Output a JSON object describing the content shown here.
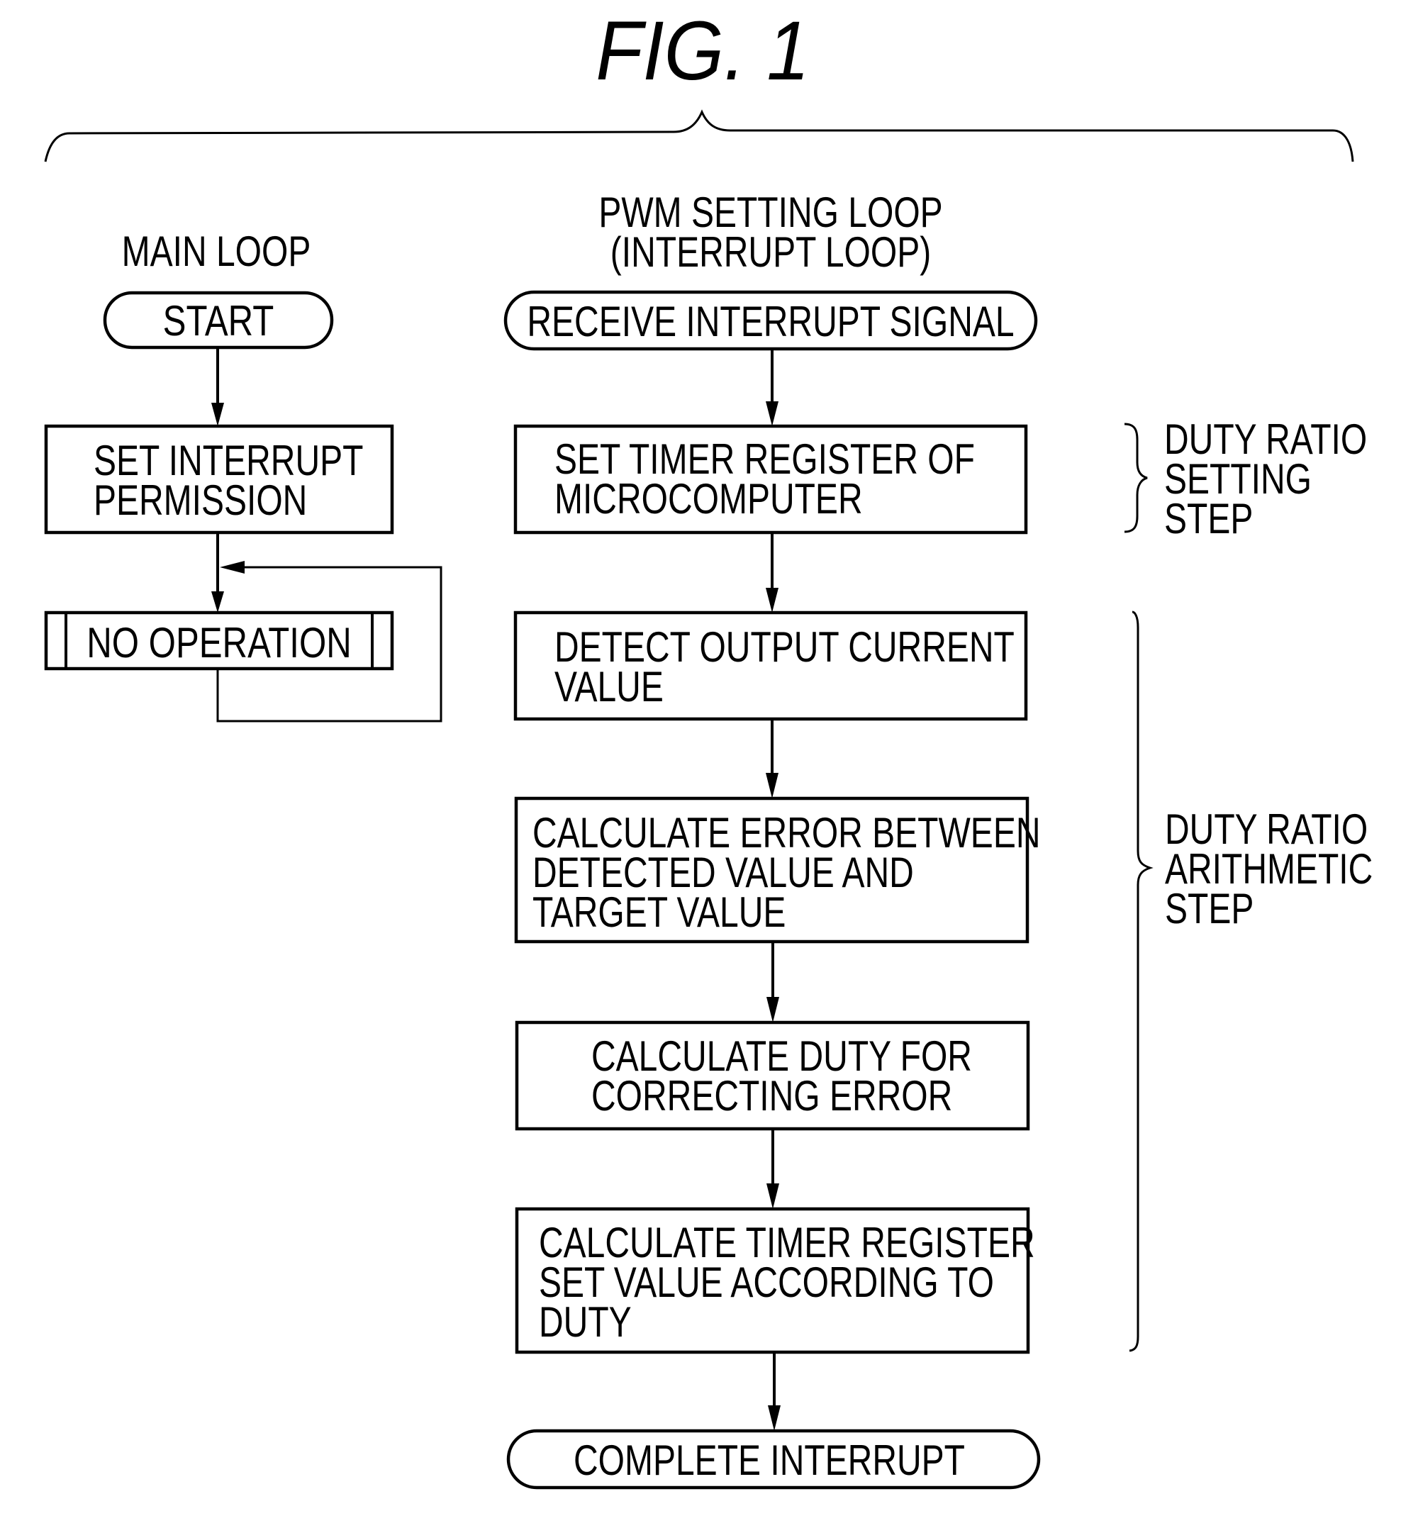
{
  "figure": {
    "title": "FIG. 1"
  },
  "main_loop": {
    "heading": "MAIN LOOP",
    "start": "START",
    "set_interrupt": [
      "SET INTERRUPT",
      "PERMISSION"
    ],
    "no_operation": "NO OPERATION"
  },
  "pwm_loop": {
    "heading": [
      "PWM SETTING LOOP",
      "(INTERRUPT LOOP)"
    ],
    "receive": "RECEIVE INTERRUPT SIGNAL",
    "set_timer": [
      "SET TIMER REGISTER OF",
      "MICROCOMPUTER"
    ],
    "detect": [
      "DETECT OUTPUT CURRENT",
      "VALUE"
    ],
    "calc_error": [
      "CALCULATE ERROR BETWEEN",
      "DETECTED VALUE AND",
      "TARGET VALUE"
    ],
    "calc_duty": [
      "CALCULATE DUTY FOR",
      "CORRECTING ERROR"
    ],
    "calc_timer": [
      "CALCULATE TIMER REGISTER",
      "SET VALUE ACCORDING TO",
      "DUTY"
    ],
    "complete": "COMPLETE INTERRUPT"
  },
  "annotations": {
    "duty_setting": [
      "DUTY RATIO",
      "SETTING",
      "STEP"
    ],
    "duty_arithmetic": [
      "DUTY RATIO",
      "ARITHMETIC",
      "STEP"
    ]
  }
}
